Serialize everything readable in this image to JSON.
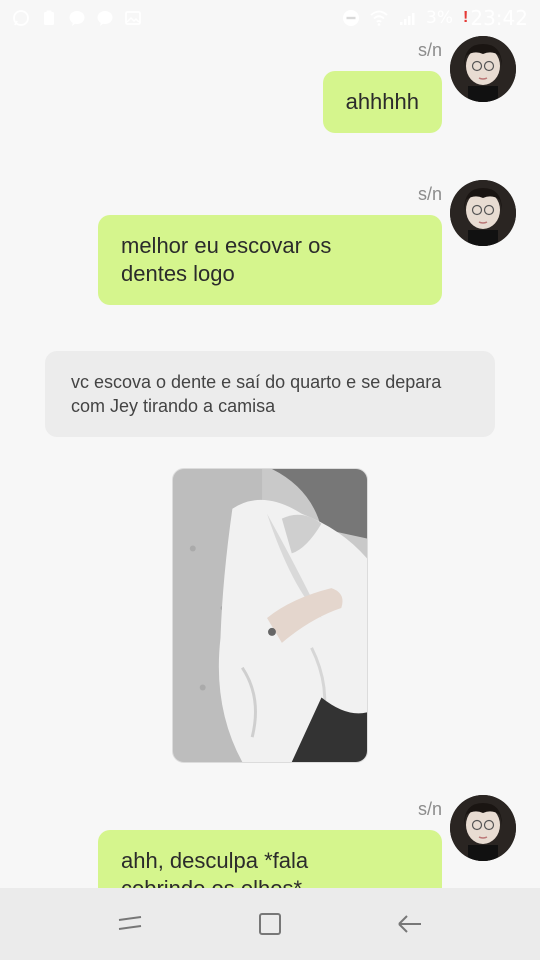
{
  "status_bar": {
    "left_icons": [
      "whatsapp-icon",
      "clipboard-icon",
      "messenger-icon",
      "messenger-icon-2",
      "gallery-icon"
    ],
    "right_icons": [
      "dnd-icon",
      "wifi-icon",
      "signal-icon"
    ],
    "alert": "!",
    "battery": "3%",
    "time": "23:42"
  },
  "messages": [
    {
      "sender": "s/n",
      "text": "ahhhhh",
      "kind": "user"
    },
    {
      "sender": "s/n",
      "text": "melhor eu escovar os\ndentes logo",
      "kind": "user"
    },
    {
      "text": "vc escova o dente e saí do quarto e se depara com Jey tirando a camisa",
      "kind": "narration"
    },
    {
      "kind": "image",
      "image": "photo-card"
    },
    {
      "sender": "s/n",
      "text": "ahh, desculpa *fala\ncobrindo os olhos*",
      "kind": "user"
    }
  ],
  "nav": {
    "recent": "recent-apps-icon",
    "home": "home-icon",
    "back": "back-icon"
  },
  "colors": {
    "user_bubble": "#d5f58d",
    "narration_bubble": "#ececec",
    "background": "#f7f7f7",
    "nav_background": "#ebebeb"
  }
}
